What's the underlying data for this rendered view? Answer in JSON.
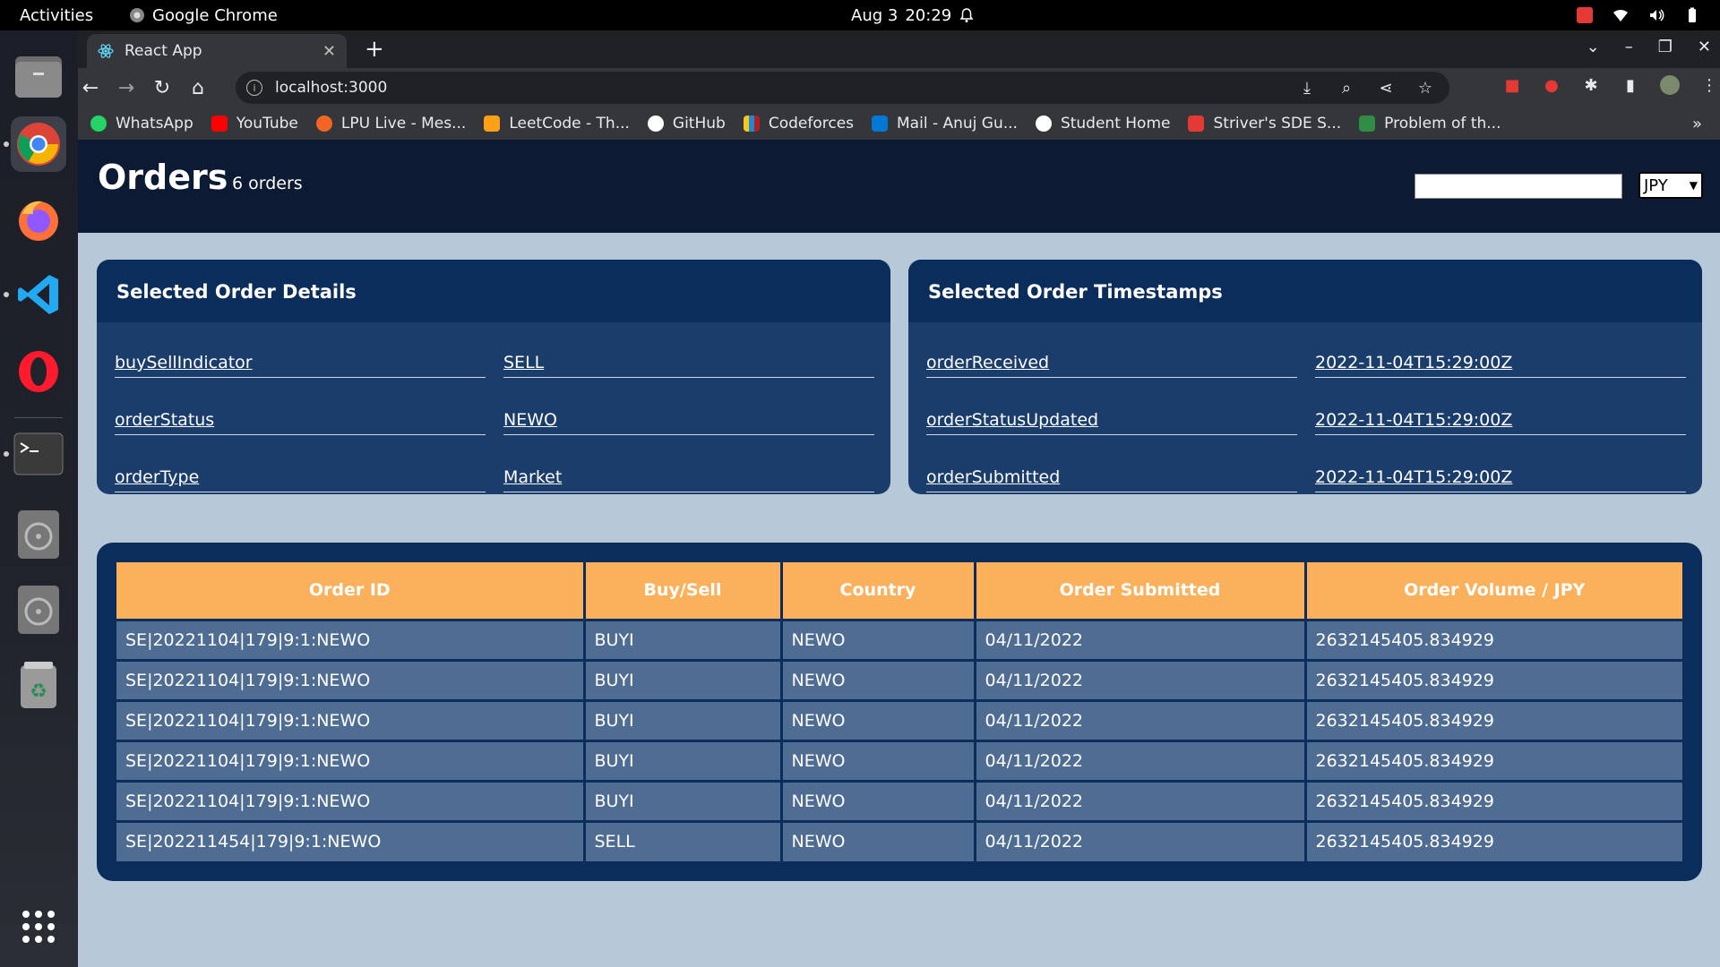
{
  "system_bar": {
    "activities": "Activities",
    "app_name": "Google Chrome",
    "date": "Aug 3",
    "time": "20:29"
  },
  "browser": {
    "tab_title": "React App",
    "url": "localhost:3000",
    "bookmarks": [
      {
        "label": "WhatsApp",
        "color": "#25d366"
      },
      {
        "label": "YouTube",
        "color": "#ff0000"
      },
      {
        "label": "LPU Live - Mes...",
        "color": "#f26522"
      },
      {
        "label": "LeetCode - Th...",
        "color": "#ffa116"
      },
      {
        "label": "GitHub",
        "color": "#ffffff"
      },
      {
        "label": "Codeforces",
        "color": "#1f8acb"
      },
      {
        "label": "Mail - Anuj Gu...",
        "color": "#0078d4"
      },
      {
        "label": "Student Home",
        "color": "#ffffff"
      },
      {
        "label": "Striver's SDE S...",
        "color": "#e53935"
      },
      {
        "label": "Problem of th...",
        "color": "#2f8d46"
      }
    ]
  },
  "header": {
    "title": "Orders",
    "order_count": "6 orders",
    "currency": "JPY"
  },
  "details_card": {
    "title": "Selected Order Details",
    "rows": [
      {
        "key": "buySellIndicator",
        "value": "SELL"
      },
      {
        "key": "orderStatus",
        "value": "NEWO"
      },
      {
        "key": "orderType",
        "value": "Market"
      }
    ]
  },
  "timestamps_card": {
    "title": "Selected Order Timestamps",
    "rows": [
      {
        "key": "orderReceived",
        "value": "2022-11-04T15:29:00Z"
      },
      {
        "key": "orderStatusUpdated",
        "value": "2022-11-04T15:29:00Z"
      },
      {
        "key": "orderSubmitted",
        "value": "2022-11-04T15:29:00Z"
      }
    ]
  },
  "table": {
    "headers": [
      "Order ID",
      "Buy/Sell",
      "Country",
      "Order Submitted",
      "Order Volume / JPY"
    ],
    "rows": [
      [
        "SE|20221104|179|9:1:NEWO",
        "BUYI",
        "NEWO",
        "04/11/2022",
        "2632145405.834929"
      ],
      [
        "SE|20221104|179|9:1:NEWO",
        "BUYI",
        "NEWO",
        "04/11/2022",
        "2632145405.834929"
      ],
      [
        "SE|20221104|179|9:1:NEWO",
        "BUYI",
        "NEWO",
        "04/11/2022",
        "2632145405.834929"
      ],
      [
        "SE|20221104|179|9:1:NEWO",
        "BUYI",
        "NEWO",
        "04/11/2022",
        "2632145405.834929"
      ],
      [
        "SE|20221104|179|9:1:NEWO",
        "BUYI",
        "NEWO",
        "04/11/2022",
        "2632145405.834929"
      ],
      [
        "SE|202211454|179|9:1:NEWO",
        "SELL",
        "NEWO",
        "04/11/2022",
        "2632145405.834929"
      ]
    ]
  }
}
